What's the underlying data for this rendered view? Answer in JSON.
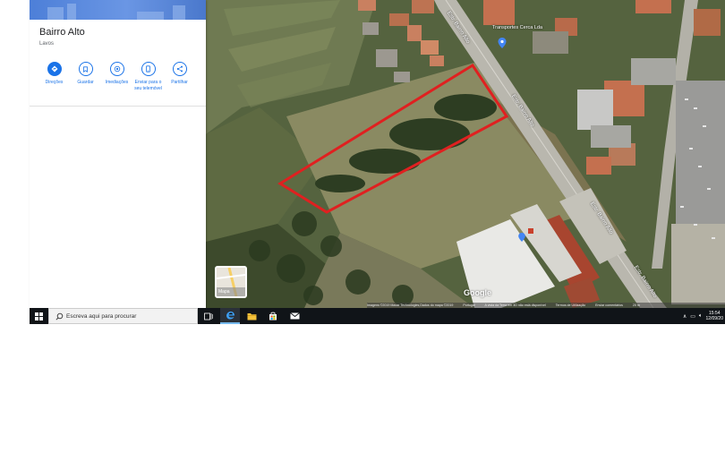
{
  "place": {
    "title": "Bairro Alto",
    "subtitle": "Lavos"
  },
  "actions": [
    {
      "label": "Direções",
      "icon": "directions-icon"
    },
    {
      "label": "Guardar",
      "icon": "bookmark-icon"
    },
    {
      "label": "Imediações",
      "icon": "nearby-icon"
    },
    {
      "label": "Enviar para o seu telemóvel",
      "icon": "send-to-phone-icon"
    },
    {
      "label": "Partilhar",
      "icon": "share-icon"
    }
  ],
  "map": {
    "street_labels": [
      "Estr. Bairro Alto",
      "Estr. Bairro Alto",
      "Estr. Bairro Alto",
      "Estr. Bairro Alto"
    ],
    "poi_label": "Transportes Cerca Lda",
    "layer_button_label": "Mapa",
    "google_logo": "Google",
    "attribution": [
      "Imagens ©2019 Maxar Technologies,Dados do mapa ©2019",
      "Portugal",
      "A vista da Terra em 3D não está disponível",
      "Termos de Utilização",
      "Enviar comentários",
      "20 m"
    ],
    "highlight_color": "#e02020"
  },
  "taskbar": {
    "search_placeholder": "Escreva aqui para procurar",
    "apps": [
      "task-view-icon",
      "edge-icon",
      "file-explorer-icon",
      "store-icon",
      "mail-icon"
    ],
    "time": "15:54",
    "date": "12/09/20"
  }
}
